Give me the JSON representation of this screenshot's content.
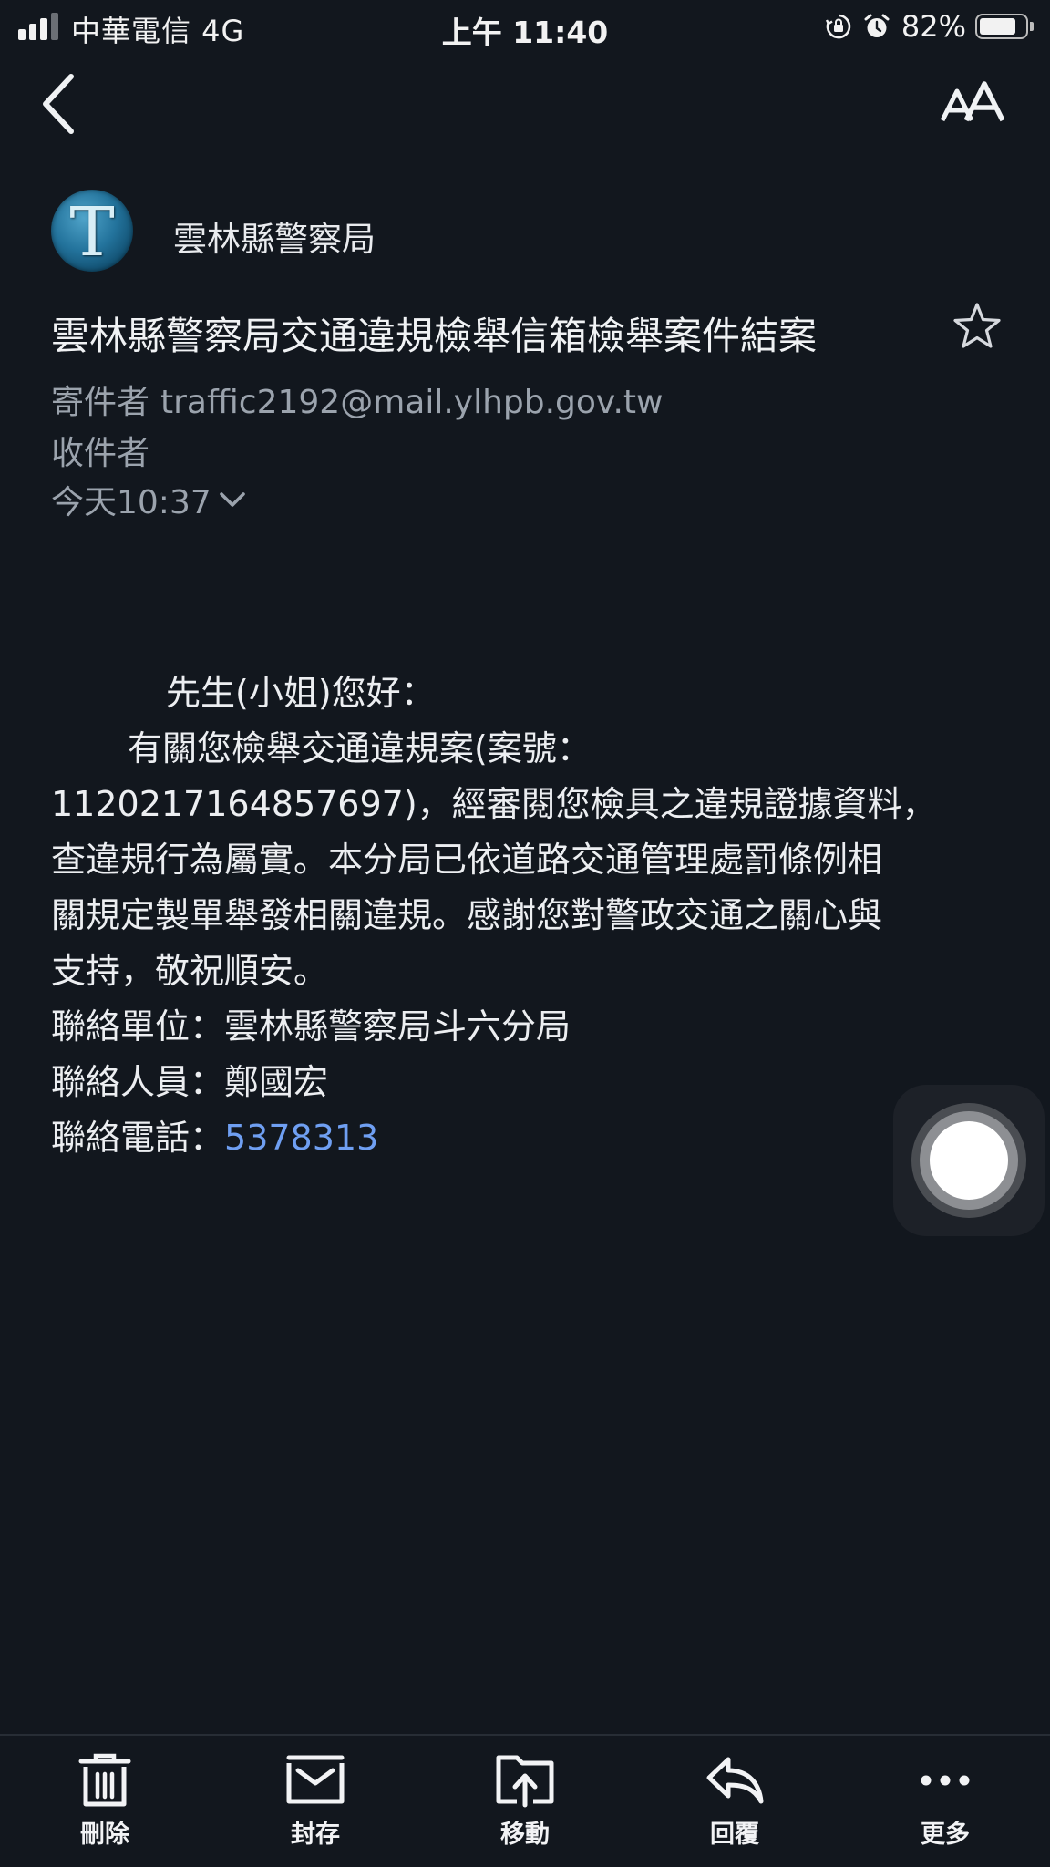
{
  "status_bar": {
    "carrier": "中華電信  4G",
    "time": "上午 11:40",
    "battery_percent": "82%",
    "battery_level": 0.82,
    "icons": [
      "signal-icon",
      "orientation-lock-icon",
      "alarm-icon",
      "battery-icon"
    ]
  },
  "nav": {
    "back_icon": "chevron-left-icon",
    "text_size_icon": "text-size-icon"
  },
  "sender": {
    "avatar_letter": "T",
    "name": "雲林縣警察局"
  },
  "email": {
    "subject": "雲林縣警察局交通違規檢舉信箱檢舉案件結案",
    "from_label": "寄件者",
    "from_address": "traffic2192@mail.ylhpb.gov.tw",
    "to_label": "收件者",
    "date": "今天10:37"
  },
  "body": {
    "greeting": "先生(小姐)您好：",
    "line1": "有關您檢舉交通違規案(案號：",
    "line2": "1120217164857697)，經審閱您檢具之違規證據資料，",
    "line3": "查違規行為屬實。本分局已依道路交通管理處罰條例相",
    "line4": "關規定製單舉發相關違規。感謝您對警政交通之關心與",
    "line5": "支持，敬祝順安。",
    "contact_unit": "聯絡單位：雲林縣警察局斗六分局",
    "contact_person": "聯絡人員：鄭國宏",
    "contact_phone_label": "聯絡電話：",
    "contact_phone": "5378313"
  },
  "toolbar": {
    "delete": "刪除",
    "archive": "封存",
    "move": "移動",
    "reply": "回覆",
    "more": "更多"
  },
  "colors": {
    "background": "#12171e",
    "text": "#e9ebee",
    "muted": "#9ba3ad",
    "link": "#6f9ff2"
  }
}
